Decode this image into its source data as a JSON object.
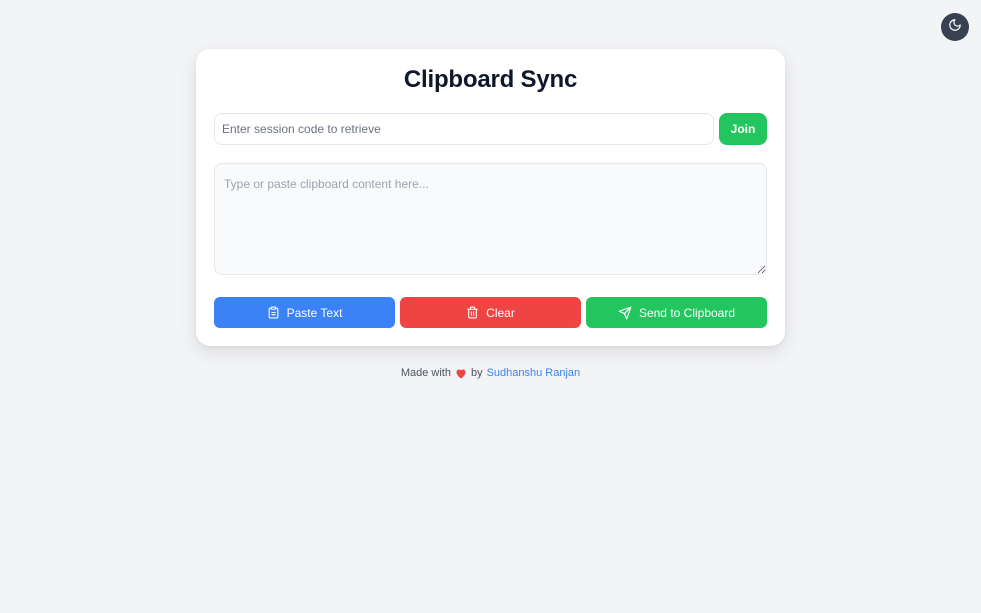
{
  "header": {
    "theme_toggle_icon": "moon-icon"
  },
  "card": {
    "title": "Clipboard Sync",
    "session": {
      "placeholder": "Enter session code to retrieve",
      "value": "",
      "join_label": "Join"
    },
    "content": {
      "placeholder": "Type or paste clipboard content here...",
      "value": ""
    },
    "actions": {
      "paste": {
        "label": "Paste Text",
        "icon": "clipboard-icon",
        "color": "#3b82f6"
      },
      "clear": {
        "label": "Clear",
        "icon": "trash-icon",
        "color": "#ef4444"
      },
      "send": {
        "label": "Send to Clipboard",
        "icon": "send-icon",
        "color": "#22c55e"
      }
    }
  },
  "footer": {
    "prefix": "Made with",
    "heart_icon": "heart-icon",
    "by": "by",
    "author": "Sudhanshu Ranjan",
    "author_color": "#3b82f6"
  }
}
